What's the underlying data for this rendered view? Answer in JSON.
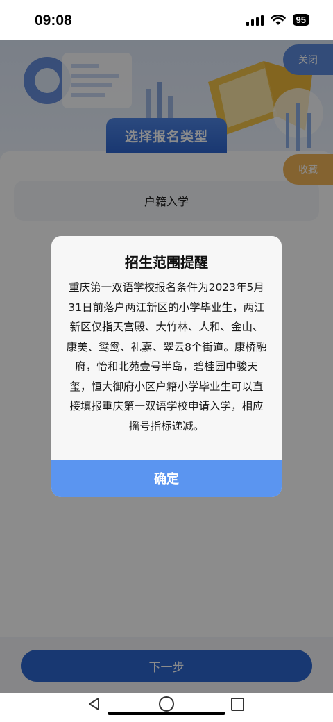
{
  "status_bar": {
    "time": "09:08",
    "battery": "95",
    "icons": [
      "signal-icon",
      "wifi-icon",
      "battery-icon"
    ]
  },
  "header": {
    "close_label": "关闭",
    "favorite_label": "收藏",
    "section_title": "选择报名类型"
  },
  "options": [
    {
      "label": "户籍入学"
    }
  ],
  "footer": {
    "next_label": "下一步"
  },
  "modal": {
    "title": "招生范围提醒",
    "body": "重庆第一双语学校报名条件为2023年5月31日前落户两江新区的小学毕业生，两江新区仅指天宫殿、大竹林、人和、金山、康美、鸳鸯、礼嘉、翠云8个街道。康桥融府，怡和北苑壹号半岛，碧桂园中骏天玺，恒大御府小区户籍小学毕业生可以直接填报重庆第一双语学校申请入学，相应摇号指标递减。",
    "confirm_label": "确定"
  },
  "colors": {
    "primary": "#2d66cf",
    "modal_button": "#5b95f0",
    "favorite": "#f0b458",
    "close": "#5d8bdc"
  },
  "nav_bar": {
    "icons": [
      "back-icon",
      "home-icon",
      "recents-icon"
    ]
  }
}
